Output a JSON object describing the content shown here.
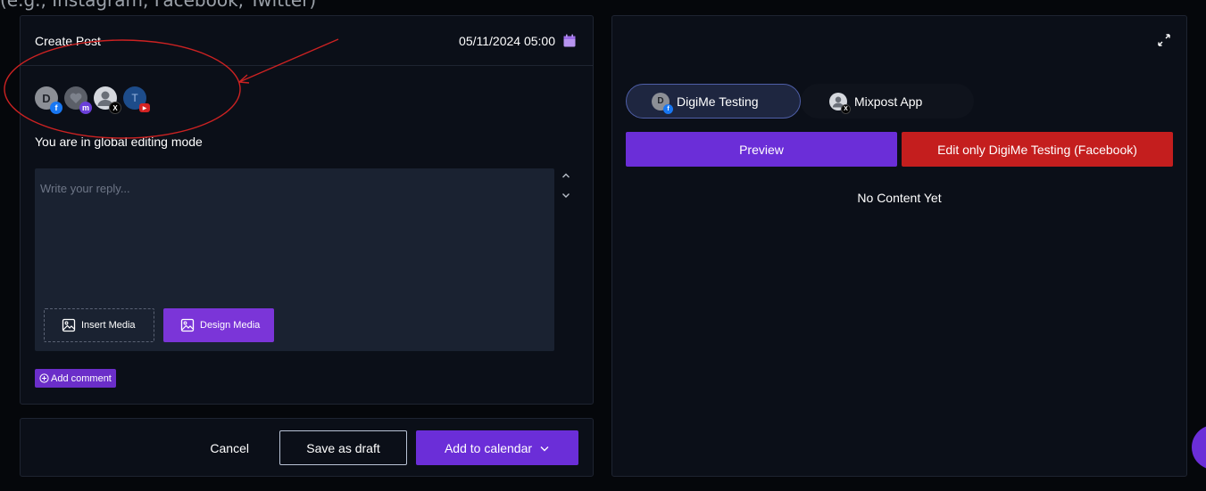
{
  "top_text": "(e.g., Instagram, Facebook, Twitter)",
  "create_post": {
    "title": "Create Post",
    "datetime": "05/11/2024 05:00",
    "accounts": [
      {
        "initial": "D",
        "network": "facebook",
        "network_glyph": "f"
      },
      {
        "initial": "",
        "network": "mastodon",
        "network_glyph": "m"
      },
      {
        "initial": "",
        "network": "x",
        "network_glyph": "X"
      },
      {
        "initial": "T",
        "network": "youtube",
        "network_glyph": "▶"
      }
    ],
    "mode_text": "You are in global editing mode",
    "editor_placeholder": "Write your reply...",
    "insert_media_label": "Insert Media",
    "design_media_label": "Design Media",
    "add_comment_label": "Add comment"
  },
  "footer": {
    "cancel_label": "Cancel",
    "save_draft_label": "Save as draft",
    "add_calendar_label": "Add to calendar"
  },
  "preview_panel": {
    "tabs": [
      {
        "label": "DigiMe Testing",
        "initial": "D",
        "network_glyph": "f",
        "active": true
      },
      {
        "label": "Mixpost App",
        "initial": "",
        "network_glyph": "X",
        "active": false
      }
    ],
    "preview_label": "Preview",
    "edit_only_label": "Edit only DigiMe Testing (Facebook)",
    "empty_text": "No Content Yet"
  },
  "colors": {
    "accent": "#6b2ed8",
    "danger": "#c41e1e",
    "annotation": "#cc2222"
  }
}
